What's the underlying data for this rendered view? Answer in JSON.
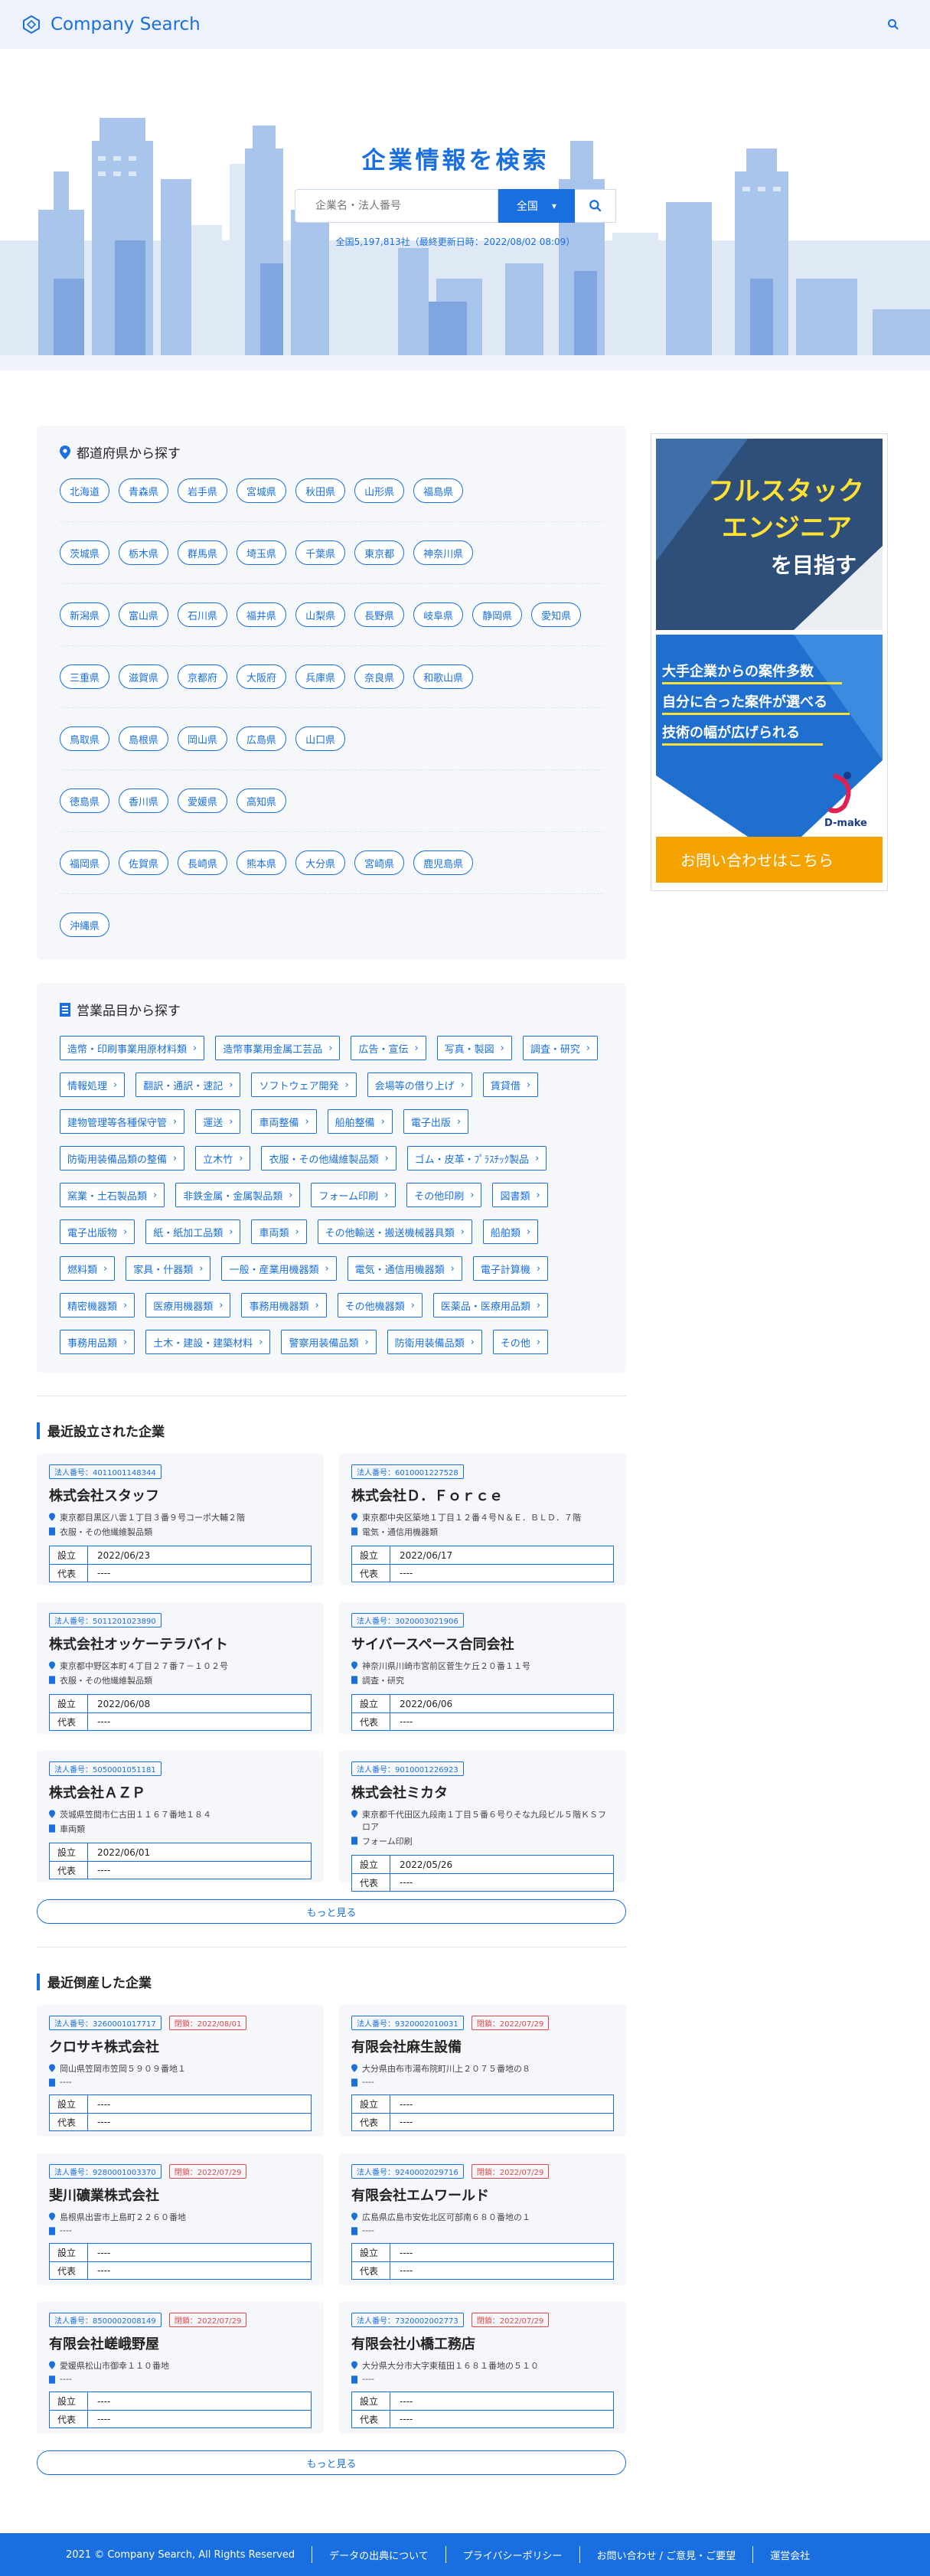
{
  "header": {
    "brand": "Company Search"
  },
  "hero": {
    "title": "企業情報を検索",
    "placeholder": "企業名・法人番号",
    "select": "全国",
    "count": "全国5,197,813社（最終更新日時：2022/08/02 08:09）"
  },
  "prefectures": {
    "title": "都道府県から探す",
    "rows": [
      [
        "北海道",
        "青森県",
        "岩手県",
        "宮城県",
        "秋田県",
        "山形県",
        "福島県"
      ],
      [
        "茨城県",
        "栃木県",
        "群馬県",
        "埼玉県",
        "千葉県",
        "東京都",
        "神奈川県"
      ],
      [
        "新潟県",
        "富山県",
        "石川県",
        "福井県",
        "山梨県",
        "長野県",
        "岐阜県",
        "静岡県",
        "愛知県"
      ],
      [
        "三重県",
        "滋賀県",
        "京都府",
        "大阪府",
        "兵庫県",
        "奈良県",
        "和歌山県"
      ],
      [
        "鳥取県",
        "島根県",
        "岡山県",
        "広島県",
        "山口県"
      ],
      [
        "徳島県",
        "香川県",
        "愛媛県",
        "高知県"
      ],
      [
        "福岡県",
        "佐賀県",
        "長崎県",
        "熊本県",
        "大分県",
        "宮崎県",
        "鹿児島県"
      ],
      [
        "沖縄県"
      ]
    ]
  },
  "categories": {
    "title": "営業品目から探す",
    "items": [
      "造幣・印刷事業用原材料類",
      "造幣事業用金属工芸品",
      "広告・宣伝",
      "写真・製図",
      "調査・研究",
      "情報処理",
      "翻訳・通訳・速記",
      "ソフトウェア開発",
      "会場等の借り上げ",
      "賃貸借",
      "建物管理等各種保守管",
      "運送",
      "車両整備",
      "船舶整備",
      "電子出版",
      "防衛用装備品類の整備",
      "立木竹",
      "衣服・その他繊維製品類",
      "ゴム・皮革・ﾌﾟﾗｽﾁｯｸ製品",
      "窯業・土石製品類",
      "非鉄金属・金属製品類",
      "フォーム印刷",
      "その他印刷",
      "図書類",
      "電子出版物",
      "紙・紙加工品類",
      "車両類",
      "その他輸送・搬送機械器具類",
      "船舶類",
      "燃料類",
      "家具・什器類",
      "一般・産業用機器類",
      "電気・通信用機器類",
      "電子計算機",
      "精密機器類",
      "医療用機器類",
      "事務用機器類",
      "その他機器類",
      "医薬品・医療用品類",
      "事務用品類",
      "土木・建設・建築材料",
      "警察用装備品類",
      "防衛用装備品類",
      "その他"
    ]
  },
  "recent_new": {
    "title": "最近設立された企業",
    "more": "もっと見る",
    "est_label": "設立",
    "rep_label": "代表",
    "companies": [
      {
        "number": "法人番号：4011001148344",
        "name": "株式会社スタッフ",
        "address": "東京都目黒区八雲１丁目３番９号コーポ大輔２階",
        "category": "衣服・その他繊維製品類",
        "date": "2022/06/23",
        "rep": "----"
      },
      {
        "number": "法人番号：6010001227528",
        "name": "株式会社Ｄ．Ｆｏｒｃｅ",
        "address": "東京都中央区築地１丁目１２番４号Ｎ＆Ｅ．ＢＬＤ．７階",
        "category": "電気・通信用機器類",
        "date": "2022/06/17",
        "rep": "----"
      },
      {
        "number": "法人番号：5011201023890",
        "name": "株式会社オッケーテラバイト",
        "address": "東京都中野区本町４丁目２７番７－１０２号",
        "category": "衣服・その他繊維製品類",
        "date": "2022/06/08",
        "rep": "----"
      },
      {
        "number": "法人番号：3020003021906",
        "name": "サイバースペース合同会社",
        "address": "神奈川県川崎市宮前区菅生ケ丘２０番１１号",
        "category": "調査・研究",
        "date": "2022/06/06",
        "rep": "----"
      },
      {
        "number": "法人番号：5050001051181",
        "name": "株式会社ＡＺＰ",
        "address": "茨城県笠間市仁古田１１６７番地１８４",
        "category": "車両類",
        "date": "2022/06/01",
        "rep": "----"
      },
      {
        "number": "法人番号：9010001226923",
        "name": "株式会社ミカタ",
        "address": "東京都千代田区九段南１丁目５番６号りそな九段ビル５階ＫＳフロア",
        "category": "フォーム印刷",
        "date": "2022/05/26",
        "rep": "----"
      }
    ]
  },
  "recent_bankrupt": {
    "title": "最近倒産した企業",
    "more": "もっと見る",
    "est_label": "設立",
    "rep_label": "代表",
    "companies": [
      {
        "number": "法人番号：3260001017717",
        "status": "閉鎖：2022/08/01",
        "name": "クロサキ株式会社",
        "address": "岡山県笠岡市笠岡５９０９番地１",
        "category": "----",
        "date": "----",
        "rep": "----"
      },
      {
        "number": "法人番号：9320002010031",
        "status": "閉鎖：2022/07/29",
        "name": "有限会社麻生設備",
        "address": "大分県由布市湯布院町川上２０７５番地の８",
        "category": "----",
        "date": "----",
        "rep": "----"
      },
      {
        "number": "法人番号：9280001003370",
        "status": "閉鎖：2022/07/29",
        "name": "斐川礦業株式会社",
        "address": "島根県出雲市上島町２２６０番地",
        "category": "----",
        "date": "----",
        "rep": "----"
      },
      {
        "number": "法人番号：9240002029716",
        "status": "閉鎖：2022/07/29",
        "name": "有限会社エムワールド",
        "address": "広島県広島市安佐北区可部南６８０番地の１",
        "category": "----",
        "date": "----",
        "rep": "----"
      },
      {
        "number": "法人番号：8500002008149",
        "status": "閉鎖：2022/07/29",
        "name": "有限会社嵯峨野屋",
        "address": "愛媛県松山市御幸１１０番地",
        "category": "----",
        "date": "----",
        "rep": "----"
      },
      {
        "number": "法人番号：7320002002773",
        "status": "閉鎖：2022/07/29",
        "name": "有限会社小橋工務店",
        "address": "大分県大分市大字東稙田１６８１番地の５１０",
        "category": "----",
        "date": "----",
        "rep": "----"
      }
    ]
  },
  "ad": {
    "line1": "フルスタック",
    "line2": "エンジニア",
    "line3": "を目指す",
    "bullet1": "大手企業からの案件多数",
    "bullet2": "自分に合った案件が選べる",
    "bullet3": "技術の幅が広げられる",
    "brand": "D-make",
    "cta": "お問い合わせはこちら"
  },
  "footer": {
    "copyright": "2021 © Company Search, All Rights Reserved",
    "links": [
      "データの出典について",
      "プライバシーポリシー",
      "お問い合わせ / ご意見・ご要望",
      "運営会社"
    ]
  },
  "colors": {
    "accent": "#1a6fe0",
    "danger": "#e04848",
    "panel": "#f5f7fb"
  }
}
